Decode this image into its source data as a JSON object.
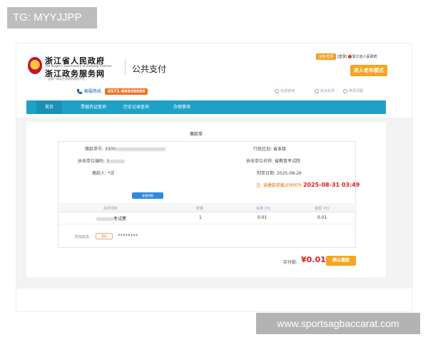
{
  "watermarks": {
    "top_left": "TG: MYYJJPP",
    "bottom_right": "www.sportsagbaccarat.com"
  },
  "header": {
    "gov_name": "浙江省人民政府",
    "gov_name_en": "The People's Government of Zhejiang Province",
    "portal_name": "浙江政务服务网",
    "portal_tagline": "全国一体化在线政务服务平台",
    "site_title": "公共支付",
    "login_label": "注册/登录",
    "user_prefix": "[登录]",
    "region_label": "浙江省人民政府",
    "elder_mode_label": "进入老年模式"
  },
  "service": {
    "hotline_label": "客服热线",
    "hotline_number": "0571-88808880",
    "utilities": [
      "在线咨询",
      "投诉反馈",
      "常见问题"
    ]
  },
  "nav": {
    "items": [
      {
        "label": "首页",
        "active": true
      },
      {
        "label": "票据凭证查询",
        "active": false
      },
      {
        "label": "历史记录查询",
        "active": false
      },
      {
        "label": "办理事项",
        "active": false
      }
    ]
  },
  "bill": {
    "title": "缴款单",
    "fields": {
      "bill_no_label": "缴款单号:",
      "bill_no_value": "3300",
      "region_label": "行政区划:",
      "region_value": "省本级",
      "unit_code_label": "执收单位编码:",
      "unit_code_value": "3",
      "unit_name_label": "执收单位名称:",
      "unit_name_value": "省教育考试院",
      "payer_label": "缴款人:",
      "payer_value": "*试",
      "date_label": "制单日期:",
      "date_value": "2025-08-26"
    },
    "notice_prefix": "注: 该缴款单截止时间为",
    "deadline": "2025-08-31 03:49",
    "detail_button": "查看明细",
    "table": {
      "headers": [
        "执收项目",
        "数量",
        "标准 (元)",
        "金额 (元)"
      ],
      "rows": [
        {
          "item_suffix": "考试费",
          "qty": "1",
          "standard": "0.01",
          "amount": "0.01"
        }
      ]
    },
    "attachment_label": "附加信息:",
    "attachment_tag": "密码",
    "attachment_value": "••••••••",
    "paid_label": "实付款:",
    "paid_value": "¥0.01",
    "confirm_button": "确认缴款"
  },
  "colors": {
    "nav_blue": "#1fa0c8",
    "accent_orange": "#f5a623",
    "price_red": "#e02020"
  }
}
